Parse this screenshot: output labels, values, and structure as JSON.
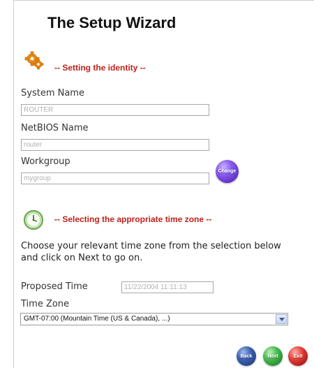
{
  "title": "The Setup Wizard",
  "identity_section": {
    "heading": "-- Setting the identity --",
    "icon": "gear-icon",
    "system_name_label": "System Name",
    "system_name_value": "ROUTER",
    "netbios_label": "NetBIOS Name",
    "netbios_value": "router",
    "workgroup_label": "Workgroup",
    "workgroup_value": "mygroup",
    "change_button": "Change"
  },
  "timezone_section": {
    "heading": "-- Selecting the appropriate time zone --",
    "icon": "clock-icon",
    "description": "Choose your relevant time zone from the selection below and click on Next to go on.",
    "proposed_time_label": "Proposed Time",
    "proposed_time_value": "11/22/2004 11:11:13",
    "timezone_label": "Time Zone",
    "timezone_selected": "GMT-07:00 (Mountain Time (US & Canada), ...)"
  },
  "nav": {
    "back": "Back",
    "next": "Next",
    "exit": "Exit"
  },
  "colors": {
    "heading_red": "#c0211a",
    "change_purple": "#6a3fd1",
    "back_blue": "#2c4f9c",
    "next_green": "#2f9e3a",
    "exit_red": "#d1262a"
  }
}
